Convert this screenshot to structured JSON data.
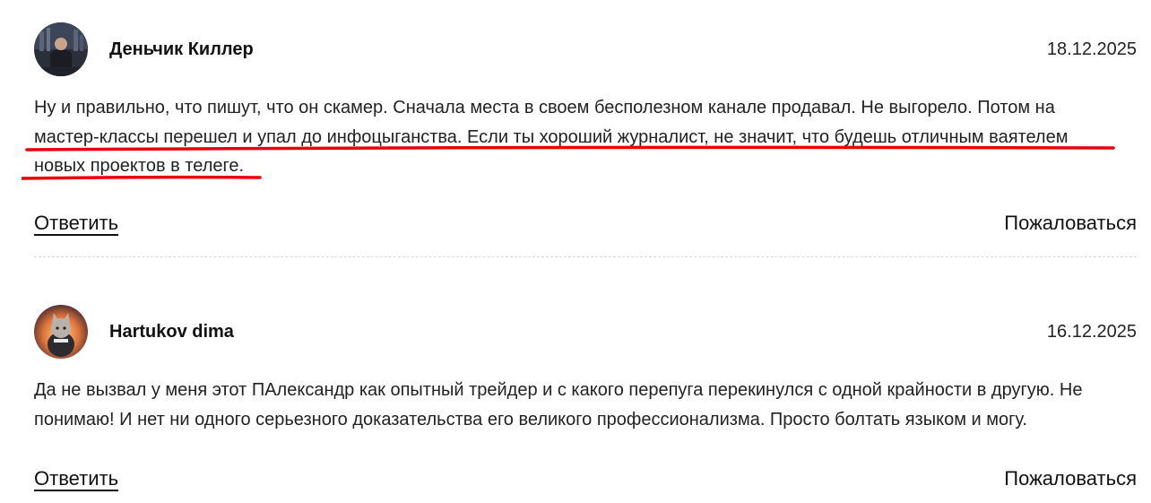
{
  "comments": [
    {
      "author": "Деньчик Киллер",
      "date": "18.12.2025",
      "text": "Ну и правильно, что пишут, что он скамер. Сначала места в своем бесполезном канале продавал. Не выгорело. Потом на мастер-классы перешел и упал до инфоцыганства. Если ты хороший журналист, не значит, что будешь отличным ваятелем новых проектов в телеге.",
      "reply_label": "Ответить",
      "report_label": "Пожаловаться",
      "highlight_color": "#e8000b"
    },
    {
      "author": "Hartukov dima",
      "date": "16.12.2025",
      "text": "Да не вызвал у меня этот ПАлександр как опытный трейдер и с какого перепуга перекинулся с одной крайности в другую. Не понимаю! И нет ни одного серьезного доказательства его великого профессионализма. Просто болтать языком и могу.",
      "reply_label": "Ответить",
      "report_label": "Пожаловаться"
    }
  ]
}
